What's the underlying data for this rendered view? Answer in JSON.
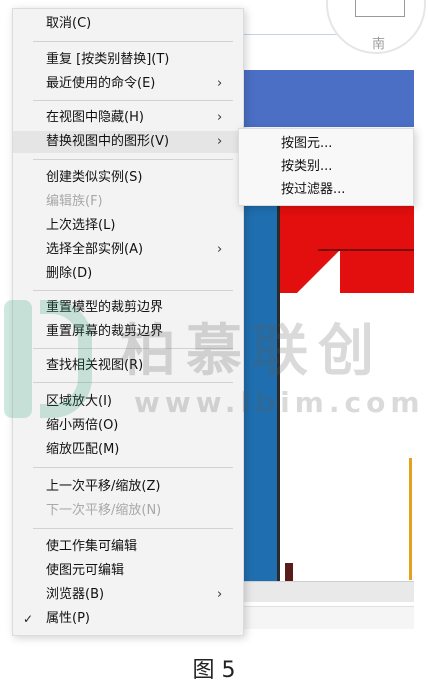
{
  "canvas": {
    "compass_label": "南"
  },
  "menu": {
    "items": [
      {
        "label": "取消(C)"
      },
      {
        "label": "重复 [按类别替换](T)"
      },
      {
        "label": "最近使用的命令(E)",
        "arrow": "›"
      },
      {
        "label": "在视图中隐藏(H)",
        "arrow": "›"
      },
      {
        "label": "替换视图中的图形(V)",
        "arrow": "›"
      },
      {
        "label": "创建类似实例(S)"
      },
      {
        "label": "编辑族(F)",
        "disabled": true
      },
      {
        "label": "上次选择(L)"
      },
      {
        "label": "选择全部实例(A)",
        "arrow": "›"
      },
      {
        "label": "删除(D)"
      },
      {
        "label": "重置模型的裁剪边界"
      },
      {
        "label": "重置屏幕的裁剪边界"
      },
      {
        "label": "查找相关视图(R)"
      },
      {
        "label": "区域放大(I)"
      },
      {
        "label": "缩小两倍(O)"
      },
      {
        "label": "缩放匹配(M)"
      },
      {
        "label": "上一次平移/缩放(Z)"
      },
      {
        "label": "下一次平移/缩放(N)",
        "disabled": true
      },
      {
        "label": "使工作集可编辑"
      },
      {
        "label": "使图元可编辑"
      },
      {
        "label": "浏览器(B)",
        "arrow": "›"
      },
      {
        "label": "属性(P)",
        "check": "✓"
      }
    ]
  },
  "submenu": {
    "items": [
      {
        "label": "按图元..."
      },
      {
        "label": "按类别..."
      },
      {
        "label": "按过滤器..."
      }
    ]
  },
  "watermark": {
    "cn": "柏慕联创",
    "url": "www.lbim.com"
  },
  "caption": "图 5"
}
